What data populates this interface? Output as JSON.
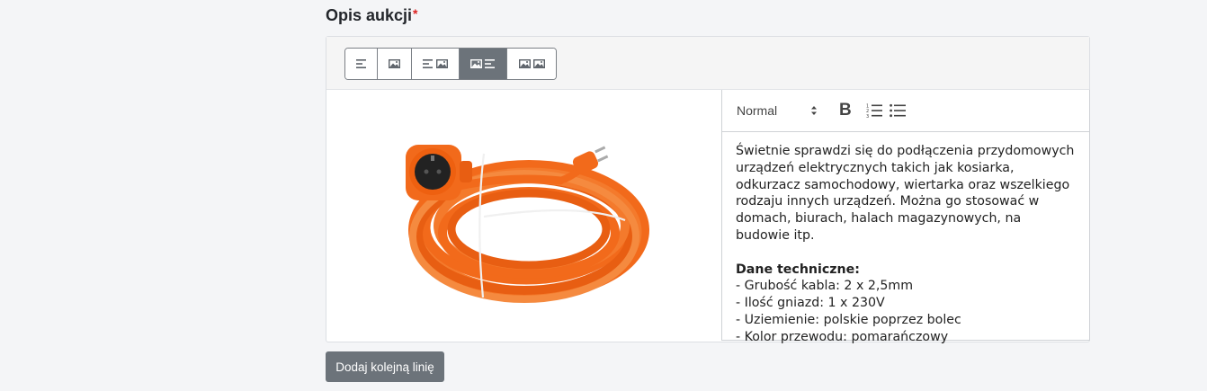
{
  "section": {
    "title": "Opis aukcji",
    "required_marker": "*"
  },
  "layout_options": [
    {
      "name": "text-only",
      "icons": [
        "text-lines-icon"
      ],
      "active": false
    },
    {
      "name": "image-only",
      "icons": [
        "image-icon"
      ],
      "active": false
    },
    {
      "name": "text-image",
      "icons": [
        "text-lines-icon",
        "image-icon"
      ],
      "active": false
    },
    {
      "name": "image-text",
      "icons": [
        "image-icon",
        "text-lines-icon"
      ],
      "active": true
    },
    {
      "name": "image-image",
      "icons": [
        "image-icon",
        "image-icon"
      ],
      "active": false
    }
  ],
  "editor": {
    "format_value": "Normal",
    "bold_label": "B",
    "content": {
      "paragraph": "Świetnie sprawdzi się do podłączenia przydomowych urządzeń elektrycznych takich jak kosiarka, odkurzacz samochodowy, wiertarka oraz wszelkiego rodzaju innych urządzeń. Można go stosować w domach, biurach, halach magazynowych, na budowie itp.",
      "spec_title": "Dane techniczne:",
      "specs": [
        "- Grubość kabla: 2 x 2,5mm",
        "- Ilość gniazd: 1 x 230V",
        "- Uziemienie: polskie poprzez bolec",
        "- Kolor przewodu: pomarańczowy"
      ]
    }
  },
  "product_image": {
    "subject": "orange extension cable reel"
  },
  "actions": {
    "add_line_label": "Dodaj kolejną linię"
  },
  "colors": {
    "accent_button": "#6c737a",
    "cable": "#f26a1b"
  }
}
